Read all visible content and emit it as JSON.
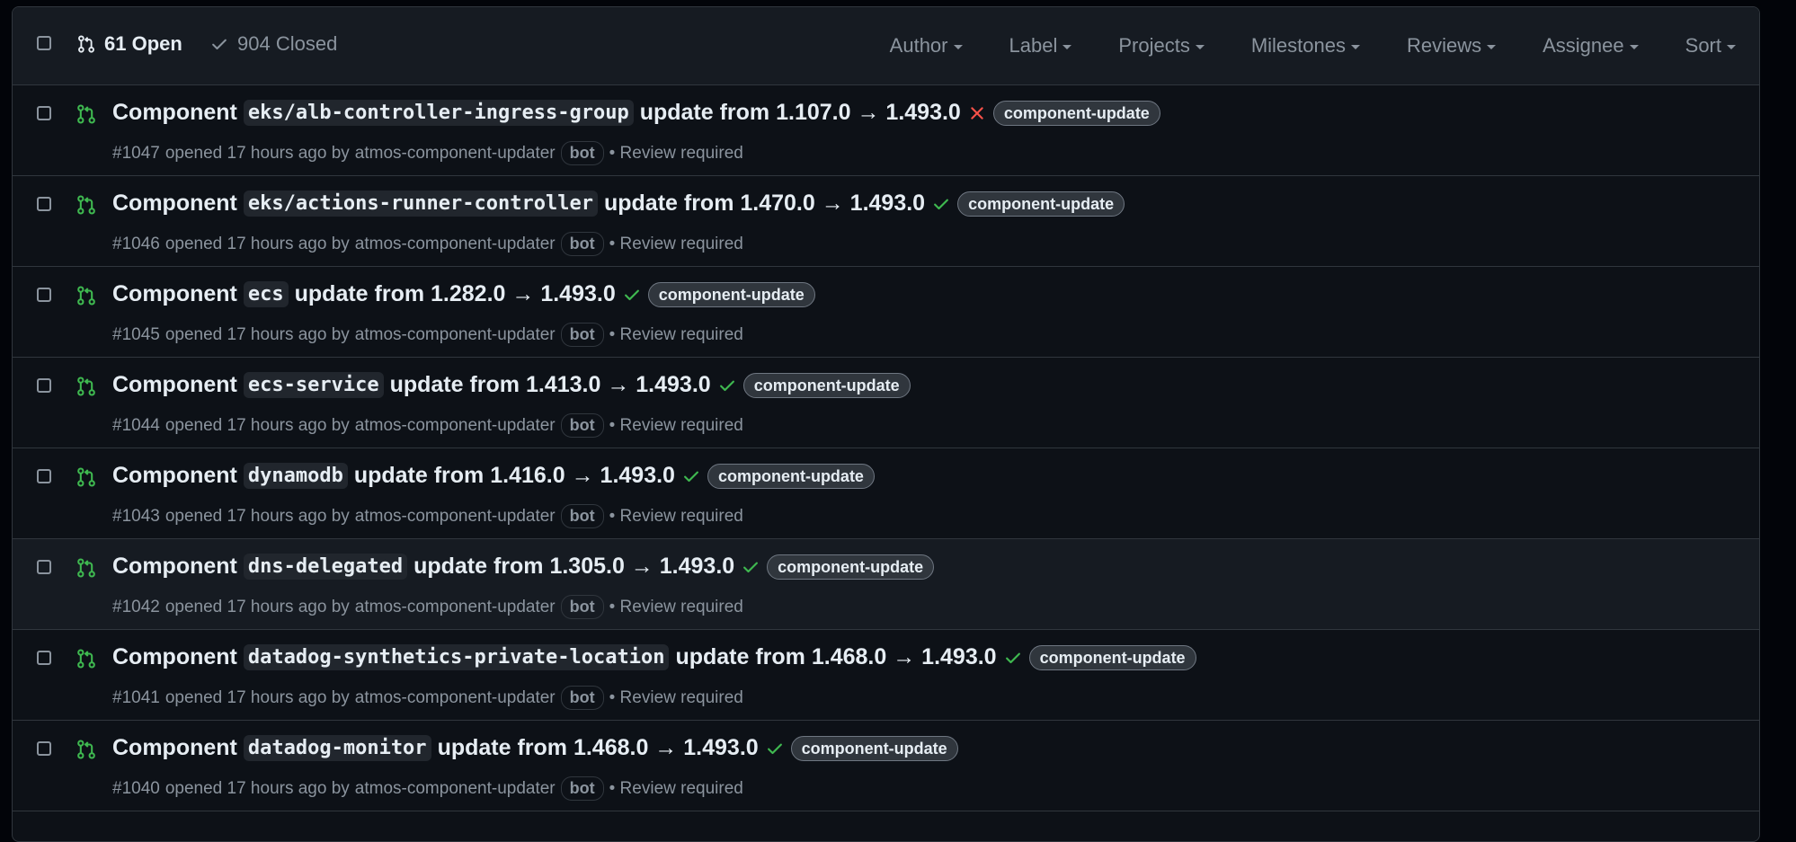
{
  "header": {
    "open_label": "61 Open",
    "closed_label": "904 Closed",
    "filters": [
      "Author",
      "Label",
      "Projects",
      "Milestones",
      "Reviews",
      "Assignee",
      "Sort"
    ]
  },
  "colors": {
    "open_green": "#3fb950",
    "fail_red": "#f85149",
    "muted": "#8b949e"
  },
  "pull_requests": [
    {
      "prefix": "Component",
      "component": "eks/alb-controller-ingress-group",
      "update_text": "update from 1.107.0 → 1.493.0",
      "status": "failure",
      "label": "component-update",
      "number": "#1047",
      "opened_text": "opened 17 hours ago by",
      "author": "atmos-component-updater",
      "author_badge": "bot",
      "review": "• Review required"
    },
    {
      "prefix": "Component",
      "component": "eks/actions-runner-controller",
      "update_text": "update from 1.470.0 → 1.493.0",
      "status": "success",
      "label": "component-update",
      "number": "#1046",
      "opened_text": "opened 17 hours ago by",
      "author": "atmos-component-updater",
      "author_badge": "bot",
      "review": "• Review required"
    },
    {
      "prefix": "Component",
      "component": "ecs",
      "update_text": "update from 1.282.0 → 1.493.0",
      "status": "success",
      "label": "component-update",
      "number": "#1045",
      "opened_text": "opened 17 hours ago by",
      "author": "atmos-component-updater",
      "author_badge": "bot",
      "review": "• Review required"
    },
    {
      "prefix": "Component",
      "component": "ecs-service",
      "update_text": "update from 1.413.0 → 1.493.0",
      "status": "success",
      "label": "component-update",
      "number": "#1044",
      "opened_text": "opened 17 hours ago by",
      "author": "atmos-component-updater",
      "author_badge": "bot",
      "review": "• Review required"
    },
    {
      "prefix": "Component",
      "component": "dynamodb",
      "update_text": "update from 1.416.0 → 1.493.0",
      "status": "success",
      "label": "component-update",
      "number": "#1043",
      "opened_text": "opened 17 hours ago by",
      "author": "atmos-component-updater",
      "author_badge": "bot",
      "review": "• Review required"
    },
    {
      "prefix": "Component",
      "component": "dns-delegated",
      "update_text": "update from 1.305.0 → 1.493.0",
      "status": "success",
      "label": "component-update",
      "number": "#1042",
      "opened_text": "opened 17 hours ago by",
      "author": "atmos-component-updater",
      "author_badge": "bot",
      "review": "• Review required"
    },
    {
      "prefix": "Component",
      "component": "datadog-synthetics-private-location",
      "update_text": "update from 1.468.0 → 1.493.0",
      "status": "success",
      "label": "component-update",
      "number": "#1041",
      "opened_text": "opened 17 hours ago by",
      "author": "atmos-component-updater",
      "author_badge": "bot",
      "review": "• Review required"
    },
    {
      "prefix": "Component",
      "component": "datadog-monitor",
      "update_text": "update from 1.468.0 → 1.493.0",
      "status": "success",
      "label": "component-update",
      "number": "#1040",
      "opened_text": "opened 17 hours ago by",
      "author": "atmos-component-updater",
      "author_badge": "bot",
      "review": "• Review required"
    }
  ]
}
